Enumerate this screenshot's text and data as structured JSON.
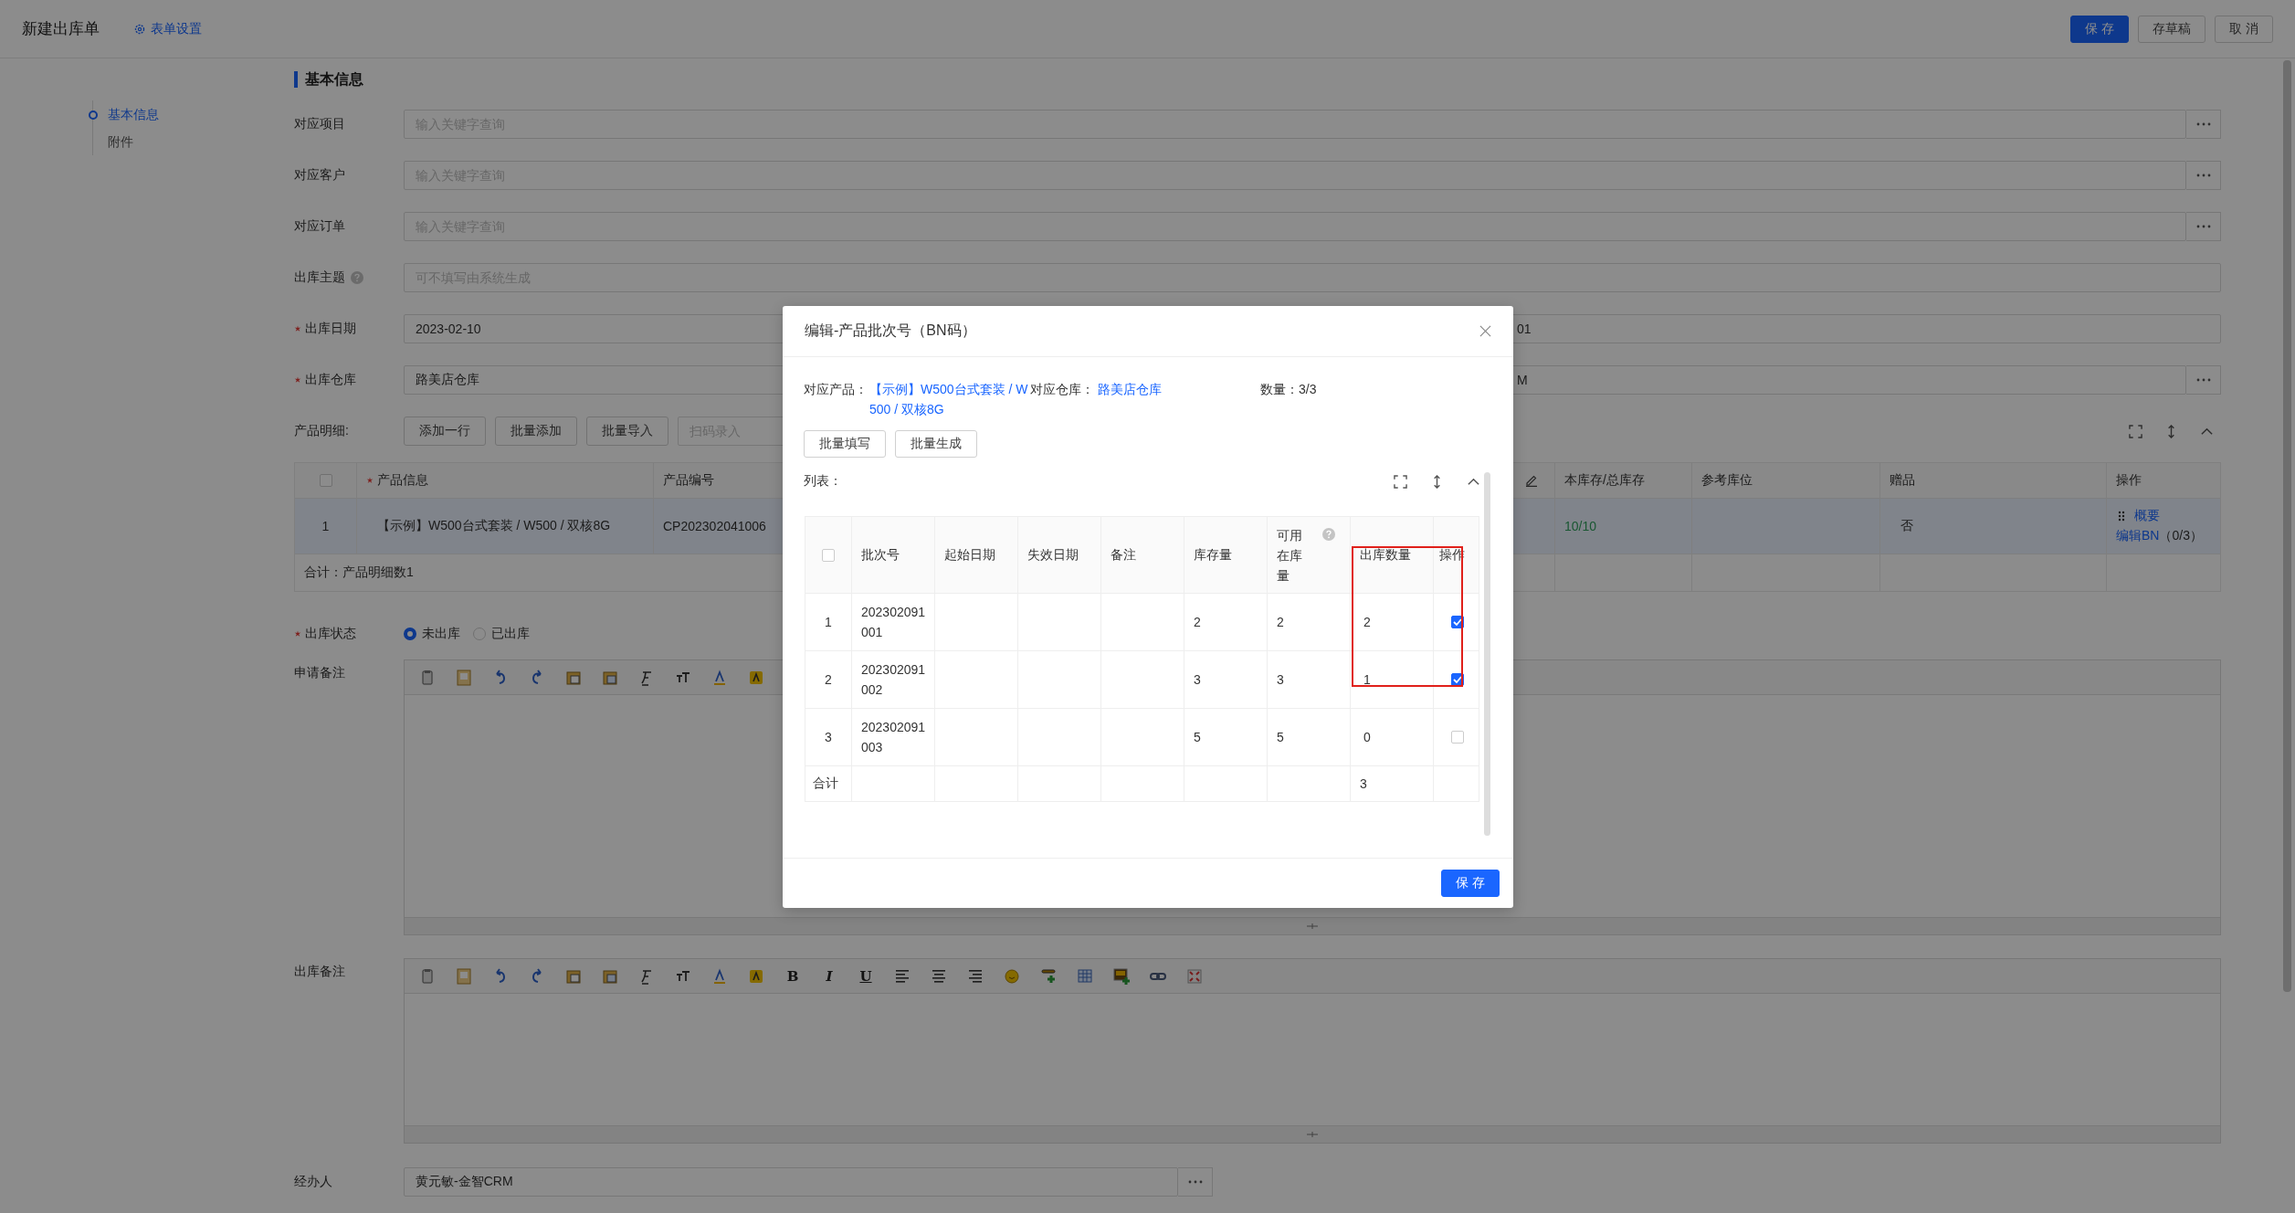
{
  "header": {
    "title": "新建出库单",
    "settings_link": "表单设置",
    "buttons": [
      {
        "label": "保 存",
        "kind": "primary"
      },
      {
        "label": "存草稿",
        "kind": "default"
      },
      {
        "label": "取 消",
        "kind": "default"
      }
    ]
  },
  "nav": [
    {
      "label": "基本信息",
      "selected": true
    },
    {
      "label": "附件",
      "selected": false
    }
  ],
  "section_title": "基本信息",
  "fields": [
    {
      "label": "对应项目",
      "required": false,
      "help": false,
      "placeholder": "输入关键字查询",
      "picker": true
    },
    {
      "label": "对应客户",
      "required": false,
      "help": false,
      "placeholder": "输入关键字查询",
      "picker": true
    },
    {
      "label": "对应订单",
      "required": false,
      "help": false,
      "placeholder": "输入关键字查询",
      "picker": true
    },
    {
      "label": "出库主题",
      "required": false,
      "help": true,
      "placeholder": "可不填写由系统生成",
      "picker": false
    },
    {
      "label": "出库日期",
      "required": true,
      "help": false,
      "value": "2023-02-10",
      "picker": false,
      "side_value": "01",
      "side_picker": false
    },
    {
      "label": "出库仓库",
      "required": true,
      "help": false,
      "value": "路美店仓库",
      "picker": false,
      "side_value": "M",
      "side_picker": true
    }
  ],
  "product_detail": {
    "label": "产品明细:",
    "select_all_checked": false,
    "buttons": [
      "添加一行",
      "批量添加",
      "批量导入"
    ],
    "scan_placeholder": "扫码录入",
    "columns": [
      {
        "label": "产品信息",
        "required": true
      },
      {
        "label": "产品编号",
        "required": false
      },
      {
        "label": "本库存/总库存",
        "required": false
      },
      {
        "label": "参考库位",
        "required": false
      },
      {
        "label": "赠品",
        "required": false
      },
      {
        "label": "操作",
        "required": false
      }
    ],
    "rows": [
      {
        "index": "1",
        "product": "【示例】W500台式套装 / W500 / 双核8G",
        "code": "CP202302041006",
        "stock": "10/10",
        "gift": "否",
        "summary_link": "概要",
        "edit_link": "编辑BN",
        "edit_count": "（0/3）"
      }
    ],
    "summary": "合计：产品明细数1"
  },
  "status": {
    "label": "出库状态",
    "required": true,
    "options": [
      {
        "label": "未出库",
        "selected": true
      },
      {
        "label": "已出库",
        "selected": false
      }
    ]
  },
  "editors": [
    {
      "label": "申请备注"
    },
    {
      "label": "出库备注",
      "format_keys": [
        "B",
        "I",
        "U"
      ]
    }
  ],
  "handler": {
    "label": "经办人",
    "value": "黄元敏-金智CRM"
  },
  "modal": {
    "title": "编辑-产品批次号（BN码）",
    "select_all_checked": false,
    "product_label": "对应产品：",
    "product": "【示例】W500台式套装 / W500 / 双核8G",
    "warehouse_label": "对应仓库：",
    "warehouse": "路美店仓库",
    "quantity": "数量：3/3",
    "buttons": [
      "批量填写",
      "批量生成"
    ],
    "list_label": "列表：",
    "columns": [
      "批次号",
      "起始日期",
      "失效日期",
      "备注",
      "库存量",
      "可用在库量",
      "出库数量",
      "操作"
    ],
    "rows": [
      {
        "index": "1",
        "batch": "202302091001",
        "stock": "2",
        "available": "2",
        "out_qty": "2",
        "checked": true
      },
      {
        "index": "2",
        "batch": "202302091002",
        "stock": "3",
        "available": "3",
        "out_qty": "1",
        "checked": true
      },
      {
        "index": "3",
        "batch": "202302091003",
        "stock": "5",
        "available": "5",
        "out_qty": "0",
        "checked": false
      }
    ],
    "total_label": "合计",
    "total": "3",
    "save": "保 存"
  }
}
